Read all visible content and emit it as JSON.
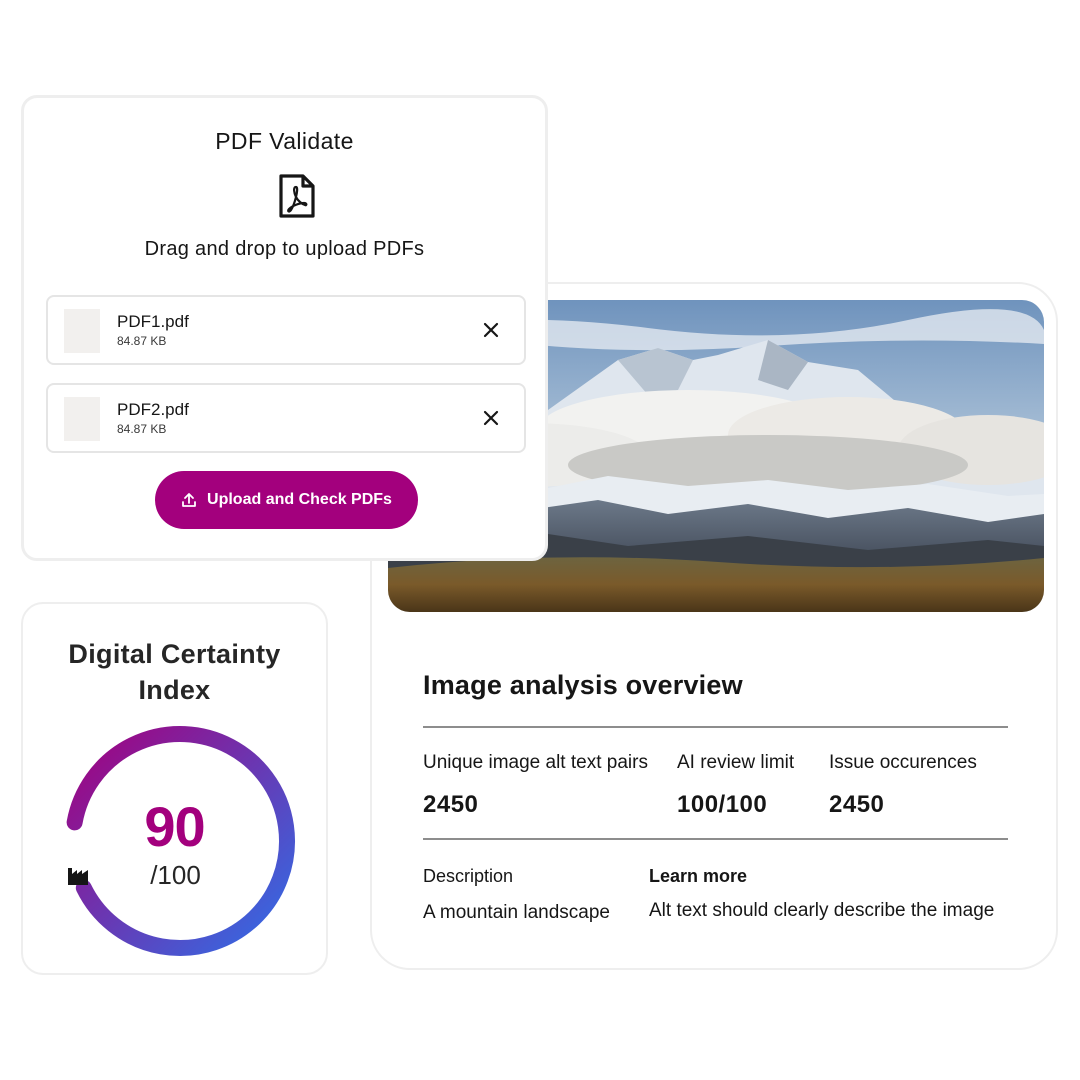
{
  "pdf_validate": {
    "title": "PDF Validate",
    "subtitle": "Drag and drop to upload PDFs",
    "files": [
      {
        "name": "PDF1.pdf",
        "size": "84.87 KB"
      },
      {
        "name": "PDF2.pdf",
        "size": "84.87 KB"
      }
    ],
    "upload_button": "Upload and Check PDFs",
    "icons": {
      "document": "pdf-file-icon",
      "remove": "close-icon",
      "upload": "upload-icon"
    }
  },
  "dci": {
    "title_line1": "Digital Certainty",
    "title_line2": "Index",
    "score": "90",
    "score_max": "/100",
    "score_fraction": 0.9,
    "icon": "factory-icon"
  },
  "analysis": {
    "title": "Image analysis overview",
    "metrics": [
      {
        "label": "Unique image alt text pairs",
        "value": "2450"
      },
      {
        "label": "AI review limit",
        "value": "100/100"
      },
      {
        "label": "Issue occurences",
        "value": "2450"
      }
    ],
    "description_heading": "Description",
    "description_text": "A mountain landscape",
    "learn_more_heading": "Learn more",
    "learn_more_text": "Alt text should clearly describe the image"
  },
  "colors": {
    "brand": "#a3007d",
    "gauge_start": "#a3007d",
    "gauge_end": "#2f6fe8",
    "rule": "#8d8d8d",
    "border": "#eeeeee"
  }
}
